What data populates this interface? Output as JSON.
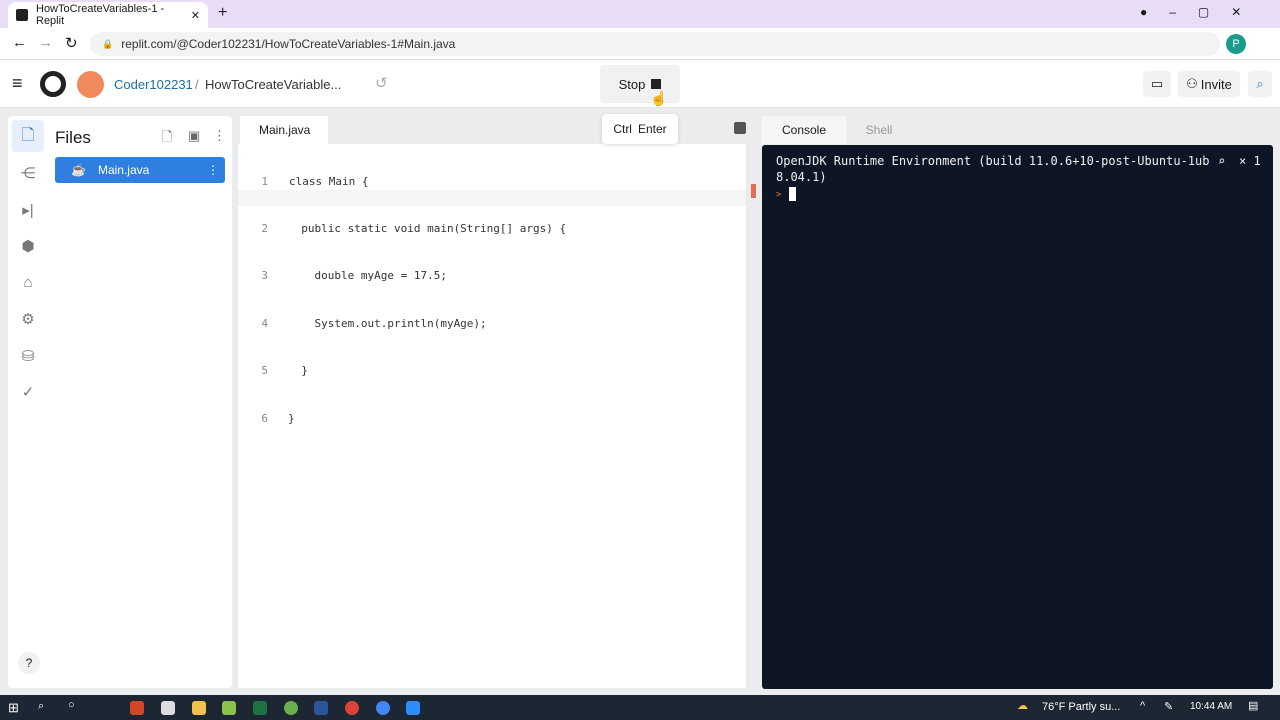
{
  "browser": {
    "tab_title": "HowToCreateVariables-1 - Replit",
    "url": "replit.com/@Coder102231/HowToCreateVariables-1#Main.java",
    "profile": "P"
  },
  "header": {
    "user": "Coder102231",
    "separator": "/",
    "repl": "HowToCreateVariable...",
    "stop_label": "Stop",
    "tooltip_keys": [
      "Ctrl",
      "Enter"
    ],
    "invite": "Invite"
  },
  "files": {
    "title": "Files",
    "items": [
      {
        "name": "Main.java",
        "selected": true
      }
    ]
  },
  "editor": {
    "tab": "Main.java",
    "lines": [
      {
        "n": "1",
        "code": "class Main {"
      },
      {
        "n": "2",
        "code": "  public static void main(String[] args) {"
      },
      {
        "n": "3",
        "code": "    double myAge = 17.5;"
      },
      {
        "n": "4",
        "code": "    System.out.println(myAge);"
      },
      {
        "n": "5",
        "code": "  }"
      },
      {
        "n": "6",
        "code": "}"
      }
    ]
  },
  "console": {
    "tabs": [
      "Console",
      "Shell"
    ],
    "output": "OpenJDK Runtime Environment (build 11.0.6+10-post-Ubuntu-1ub",
    "output2": "8.04.1)",
    "close": "× 1",
    "prompt": ">"
  },
  "taskbar": {
    "weather": "76°F  Partly su...",
    "time": "10:44 AM"
  },
  "help": "?",
  "colors": {
    "accent": "#2f7fe0",
    "terminal_bg": "#0e1525",
    "tabbar": "#e8dcf7"
  }
}
